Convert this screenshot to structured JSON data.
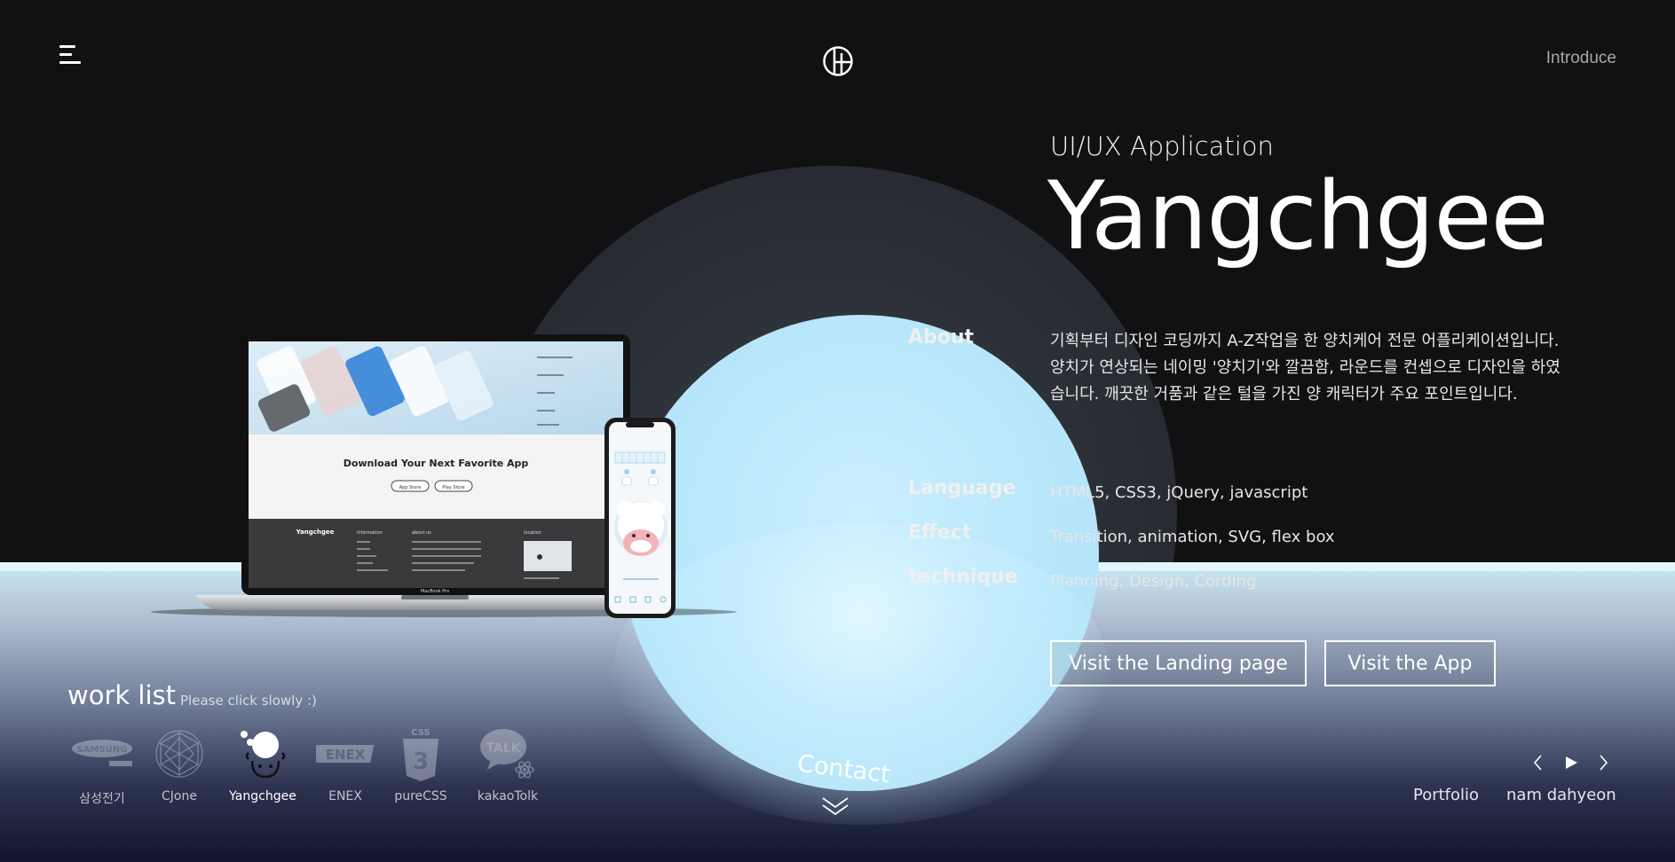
{
  "header": {
    "menu_icon": "hamburger-menu-icon",
    "logo_icon": "circle-h-logo-icon",
    "introduce_label": "Introduce"
  },
  "project": {
    "category": "UI/UX Application",
    "name": "Yangchgee",
    "info": [
      {
        "label": "About",
        "value": "기획부터 디자인 코딩까지 A-Z작업을 한 양치케어 전문 어플리케이션입니다.\n양치가 연상되는 네이밍 '양치기'와 깔끔함, 라운드를 컨셉으로 디자인을 하였습니다. 깨끗한 거품과 같은 털을 가진 양 캐릭터가 주요 포인트입니다."
      },
      {
        "label": "Language",
        "value": "HTML5, CSS3, jQuery, javascript"
      },
      {
        "label": "Effect",
        "value": "Transition, animation, SVG, flex box"
      },
      {
        "label": "technique",
        "value": "Planning, Design, Cording"
      }
    ],
    "buttons": {
      "landing": "Visit the Landing page",
      "app": "Visit the App"
    }
  },
  "mockup": {
    "laptop_heading": "Download Your Next Favorite App",
    "laptop_footer_brand": "Yangchgee",
    "laptop_footer_cols": [
      "information",
      "about us",
      "location"
    ],
    "laptop_model": "MacBook Pro",
    "laptop_store_buttons": [
      "App Store",
      "Play Store"
    ]
  },
  "worklist": {
    "title": "work list",
    "hint": "Please click slowly :)",
    "items": [
      {
        "label": "삼성전기",
        "icon": "samsung-logo-icon",
        "active": false
      },
      {
        "label": "CJone",
        "icon": "cjone-circle-logo-icon",
        "active": false
      },
      {
        "label": "Yangchgee",
        "icon": "sheep-logo-icon",
        "active": true
      },
      {
        "label": "ENEX",
        "icon": "enex-logo-icon",
        "active": false
      },
      {
        "label": "pureCSS",
        "icon": "css3-logo-icon",
        "active": false
      },
      {
        "label": "kakaoTolk",
        "icon": "kakaotalk-logo-icon",
        "active": false
      }
    ]
  },
  "contact": {
    "label": "Contact",
    "icon": "double-chevron-down-icon"
  },
  "footer": {
    "portfolio": "Portfolio",
    "author": "nam dahyeon",
    "prev_icon": "chevron-left-icon",
    "play_icon": "play-icon",
    "next_icon": "chevron-right-icon"
  },
  "colors": {
    "background": "#111113",
    "accent_light_blue": "#b7e6fb",
    "bottom_gradient_dark": "#12152c"
  }
}
